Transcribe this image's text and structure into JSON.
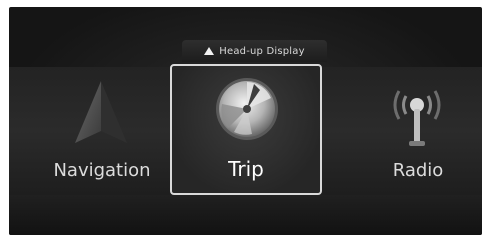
{
  "hud": {
    "label": "Head-up Display",
    "icon": "triangle-up-icon"
  },
  "menu": {
    "items": [
      {
        "label": "Navigation",
        "icon": "navigation-arrow-icon",
        "selected": false
      },
      {
        "label": "Trip",
        "icon": "trip-dial-icon",
        "selected": true
      },
      {
        "label": "Radio",
        "icon": "radio-antenna-icon",
        "selected": false
      }
    ]
  },
  "colors": {
    "screen": "#1a1a1a",
    "text": "#dcdcdc",
    "selection_border": "#d9d9d9"
  }
}
